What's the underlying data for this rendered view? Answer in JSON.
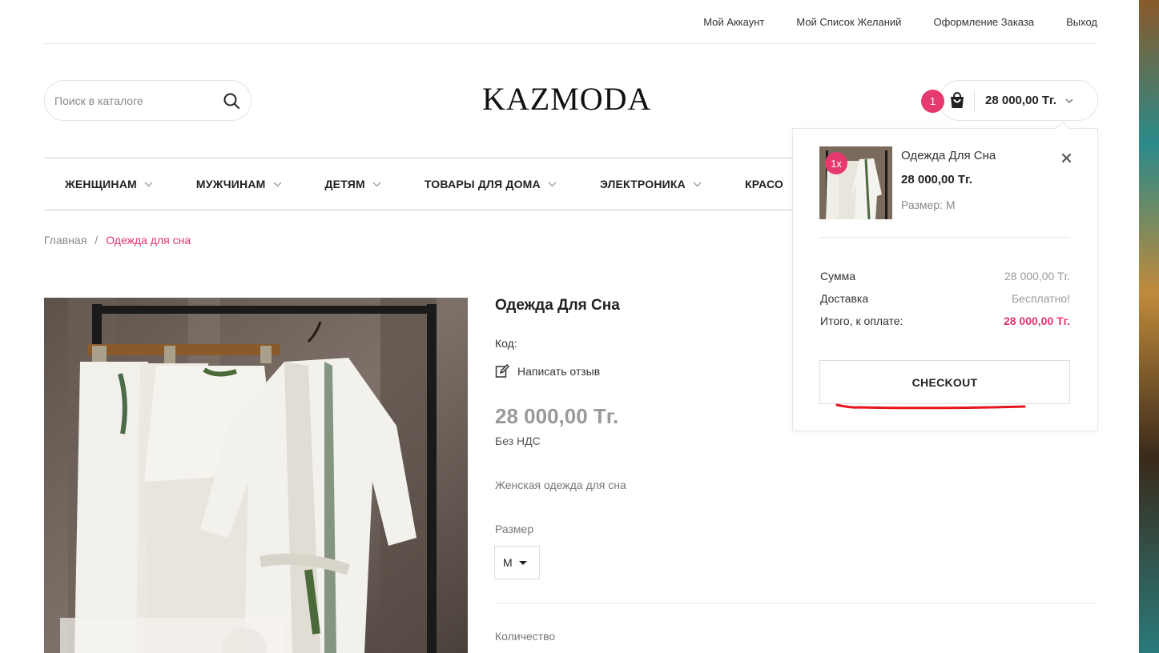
{
  "topbar": {
    "items": [
      "Мой Аккаунт",
      "Мой Список Желаний",
      "Оформление Заказа",
      "Выход"
    ]
  },
  "search": {
    "placeholder": "Поиск в каталоге"
  },
  "logo": "KAZMODA",
  "cart": {
    "count": "1",
    "total": "28 000,00 Тг."
  },
  "nav": [
    "ЖЕНЩИНАМ",
    "МУЖЧИНАМ",
    "ДЕТЯМ",
    "ТОВАРЫ ДЛЯ ДОМА",
    "ЭЛЕКТРОНИКА",
    "КРАСО"
  ],
  "breadcrumb": {
    "home": "Главная",
    "separator": "/",
    "current": "Одежда для сна"
  },
  "product": {
    "title": "Одежда Для Сна",
    "code_label": "Код:",
    "review_label": "Написать отзыв",
    "price": "28 000,00 Тг.",
    "tax_note": "Без НДС",
    "description": "Женская одежда для сна",
    "size_label": "Размер",
    "size_value": "M",
    "quantity_label": "Количество"
  },
  "cart_dropdown": {
    "item": {
      "qty": "1x",
      "name": "Одежда Для Сна",
      "price": "28 000,00 Тг.",
      "option": "Размер: M"
    },
    "summary": [
      {
        "label": "Сумма",
        "value": "28 000,00 Тг."
      },
      {
        "label": "Доставка",
        "value": "Бесплатно!"
      },
      {
        "label": "Итого, к оплате:",
        "value": "28 000,00 Тг."
      }
    ],
    "checkout_label": "CHECKOUT"
  },
  "colors": {
    "accent": "#e0366b",
    "badge": "#e63a6e",
    "annotation": "#e8141e"
  }
}
